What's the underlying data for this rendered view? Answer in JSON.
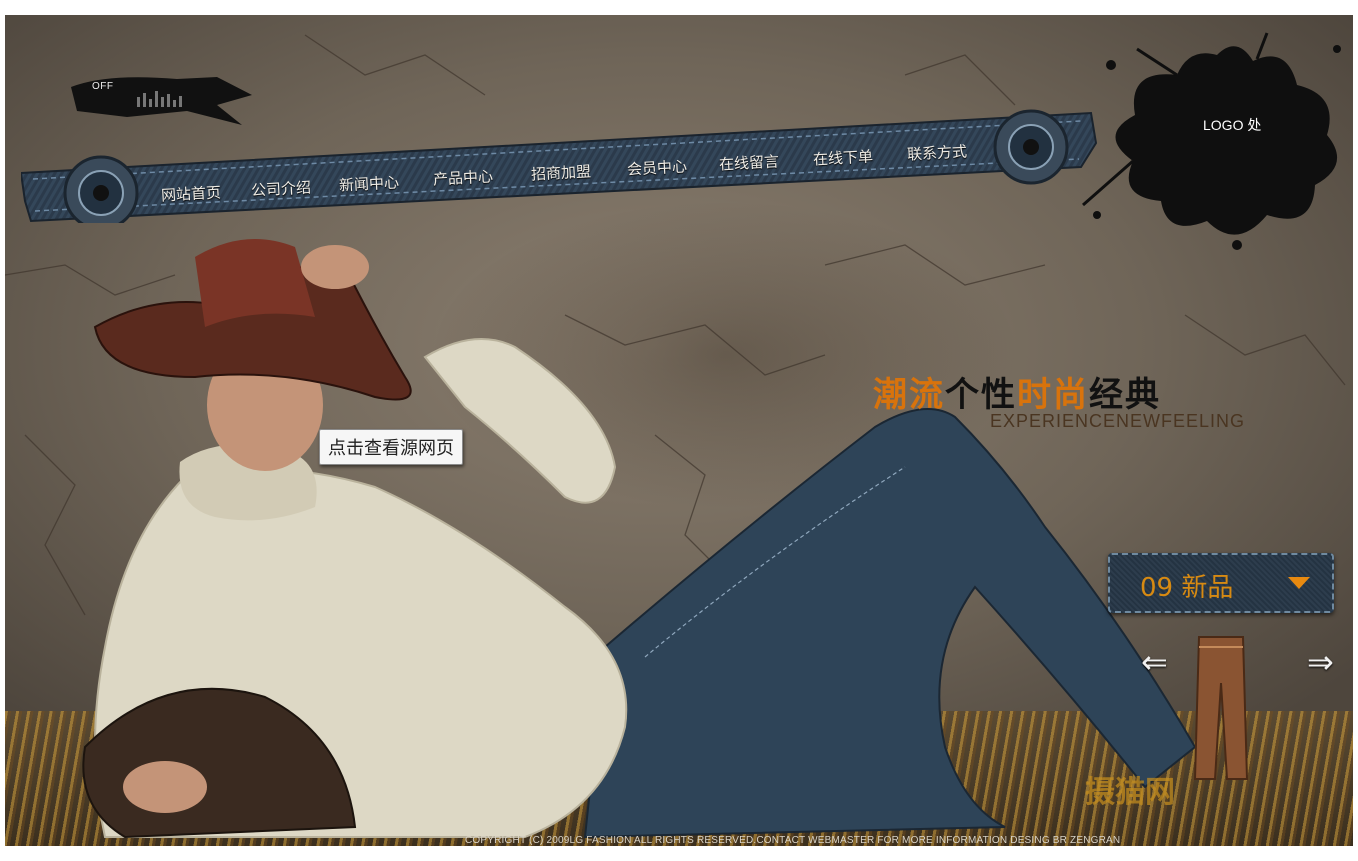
{
  "power": {
    "label": "OFF"
  },
  "nav": {
    "items": [
      "网站首页",
      "公司介绍",
      "新闻中心",
      "产品中心",
      "招商加盟",
      "会员中心",
      "在线留言",
      "在线下单",
      "联系方式"
    ]
  },
  "logo": {
    "text": "LOGO 处"
  },
  "slogan": {
    "part1": "潮流",
    "part2": "个性",
    "part3": "时尚",
    "part4": "经典",
    "en": "EXPERIENCENEWFEELING"
  },
  "tooltip": {
    "text": "点击查看源网页"
  },
  "new_products": {
    "label": "09 新品",
    "prev_icon": "left-arrow-icon",
    "next_icon": "right-arrow-icon"
  },
  "watermark": {
    "text": "摄猫网"
  },
  "footer": {
    "copyright": "COPYRIGHT (C) 2009LG FASHION ALL RIGHTS RESERVED.CONTACT WEBMASTER FOR MORE INFORMATION  DESING BR ZENGRAN"
  },
  "colors": {
    "accent": "#d8730c",
    "belt": "#2b3a4b",
    "wall": "#7a6f62"
  }
}
